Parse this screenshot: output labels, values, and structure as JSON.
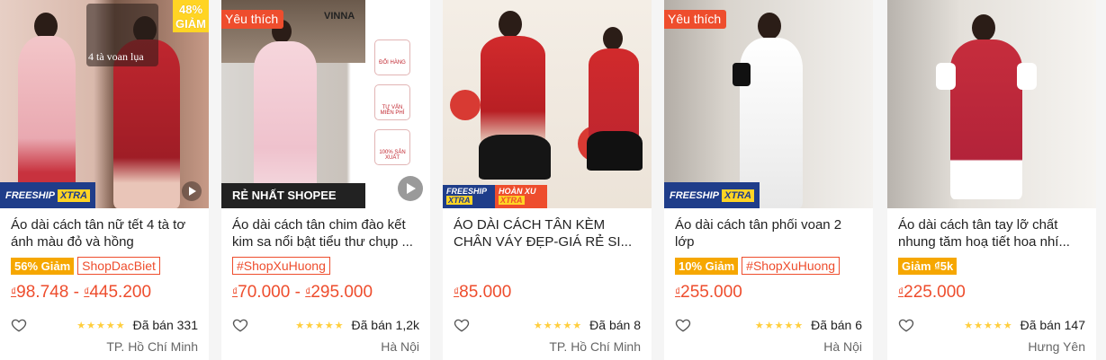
{
  "colors": {
    "accent": "#ee4d2d",
    "star": "#ffce3d",
    "sale_badge": "#f6a700",
    "freeship": "#1f3d8a"
  },
  "products": [
    {
      "title": "Áo dài cách tân nữ tết 4 tà tơ ánh màu đỏ và hồng",
      "fav_label": "",
      "discount_pct": "48%",
      "discount_word": "GIẢM",
      "image_caption": "4 tà voan lụa",
      "freeship_label": "FREESHIP",
      "freeship_badge": "XTRA",
      "sale_badge": "56% Giảm",
      "shop_badge": "ShopDacBiet",
      "currency": "₫",
      "price_min": "98.748",
      "price_sep": " - ",
      "currency2": "₫",
      "price_max": "445.200",
      "stars": "★★★★★",
      "sold": "Đã bán 331",
      "location": "TP. Hồ Chí Minh",
      "heart_icon": "heart-outline-icon"
    },
    {
      "title": "Áo dài cách tân chim đào kết kim sa nổi bật tiểu thư chụp ...",
      "fav_label": "Yêu thích",
      "image_brand": "VINNA",
      "image_banner": "RẺ NHẤT SHOPEE",
      "side_labels": [
        "ĐỔI HÀNG",
        "TƯ VẤN MIỄN PHÍ",
        "100% SẢN XUẤT"
      ],
      "sale_badge": "",
      "shop_badge": "#ShopXuHuong",
      "currency": "₫",
      "price_min": "70.000",
      "price_sep": " - ",
      "currency2": "₫",
      "price_max": "295.000",
      "stars": "★★★★★",
      "sold": "Đã bán 1,2k",
      "location": "Hà Nội"
    },
    {
      "title": "ÁO DÀI CÁCH TÂN KÈM CHÂN VÁY ĐẸP-GIÁ RẺ SI...",
      "fav_label": "",
      "freeship_label": "FREESHIP",
      "freeship_badge": "XTRA",
      "hoanxu_label": "HOÀN XU",
      "hoanxu_badge": "XTRA",
      "sale_badge": "",
      "shop_badge": "",
      "currency": "₫",
      "price_min": "85.000",
      "stars": "★★★★★",
      "sold": "Đã bán 8",
      "location": "TP. Hồ Chí Minh"
    },
    {
      "title": "Áo dài cách tân phối voan 2 lớp",
      "fav_label": "Yêu thích",
      "freeship_label": "FREESHIP",
      "freeship_badge": "XTRA",
      "sale_badge": "10% Giảm",
      "shop_badge": "#ShopXuHuong",
      "currency": "₫",
      "price_min": "255.000",
      "stars": "★★★★★",
      "sold": "Đã bán 6",
      "location": "Hà Nội"
    },
    {
      "title": "Áo dài cách tân tay lỡ chất nhung tăm hoạ tiết hoa nhí...",
      "fav_label": "",
      "sale_badge": "Giảm ₫5k",
      "shop_badge": "",
      "currency": "₫",
      "price_min": "225.000",
      "stars": "★★★★★",
      "sold": "Đã bán 147",
      "location": "Hưng Yên"
    }
  ]
}
